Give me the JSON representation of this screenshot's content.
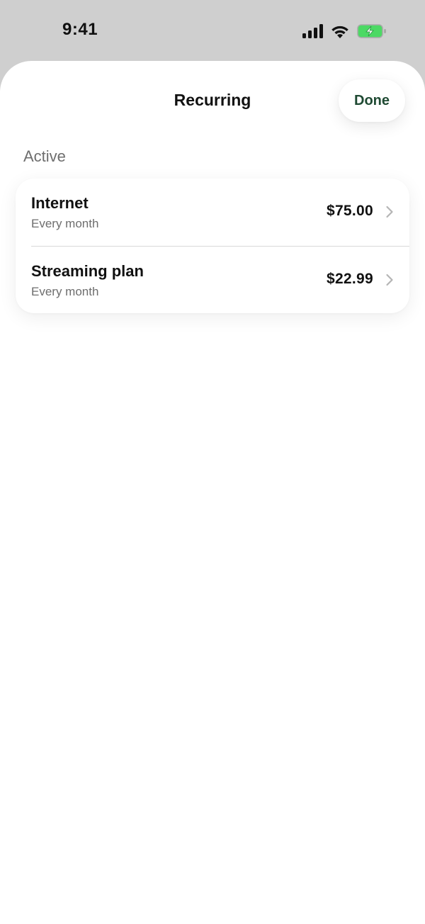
{
  "status_bar": {
    "time": "9:41",
    "icons": [
      "cellular-signal-icon",
      "wifi-icon",
      "battery-charging-icon"
    ]
  },
  "header": {
    "title": "Recurring",
    "done_label": "Done"
  },
  "section": {
    "label": "Active"
  },
  "items": [
    {
      "name": "Internet",
      "frequency": "Every month",
      "amount": "$75.00"
    },
    {
      "name": "Streaming plan",
      "frequency": "Every month",
      "amount": "$22.99"
    }
  ],
  "colors": {
    "accent": "#1f4a33",
    "battery": "#4cd964",
    "secondary_text": "#6e6e6e"
  }
}
